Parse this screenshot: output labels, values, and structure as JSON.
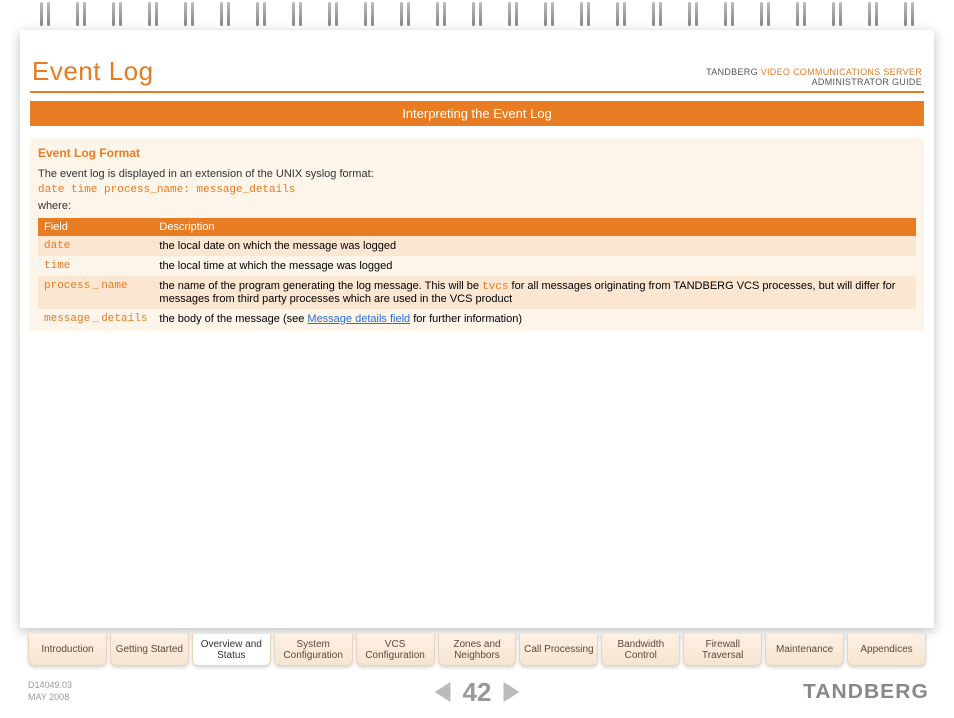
{
  "header": {
    "title": "Event Log",
    "brand": "TANDBERG",
    "product": "VIDEO COMMUNICATIONS SERVER",
    "subtitle": "ADMINISTRATOR GUIDE"
  },
  "section": {
    "bar": "Interpreting the Event Log",
    "sub_title": "Event Log Format",
    "intro": "The event log is displayed in an extension of the UNIX syslog format:",
    "format_line": "date time process_name: message_details",
    "where": "where:"
  },
  "table": {
    "headers": {
      "field": "Field",
      "description": "Description"
    },
    "rows": [
      {
        "field": "date",
        "desc_parts": [
          "the local date on which the message was logged"
        ]
      },
      {
        "field": "time",
        "desc_parts": [
          "the local time at which the message was logged"
        ]
      },
      {
        "field": "process_name",
        "desc_parts": [
          "the name of the program generating the log message. This will be ",
          {
            "mono": "tvcs"
          },
          " for all messages originating from TANDBERG VCS processes, but will differ for messages from third party processes which are used in the VCS product"
        ]
      },
      {
        "field": "message_details",
        "desc_parts": [
          "the body of the message (see ",
          {
            "link": "Message details field"
          },
          " for further information)"
        ]
      }
    ]
  },
  "tabs": [
    "Introduction",
    "Getting Started",
    "Overview and Status",
    "System Configuration",
    "VCS Configuration",
    "Zones and Neighbors",
    "Call Processing",
    "Bandwidth Control",
    "Firewall Traversal",
    "Maintenance",
    "Appendices"
  ],
  "active_tab_index": 2,
  "footer": {
    "doc_id": "D14049.03",
    "doc_date": "MAY 2008",
    "page_number": "42",
    "logo": "TANDBERG"
  }
}
